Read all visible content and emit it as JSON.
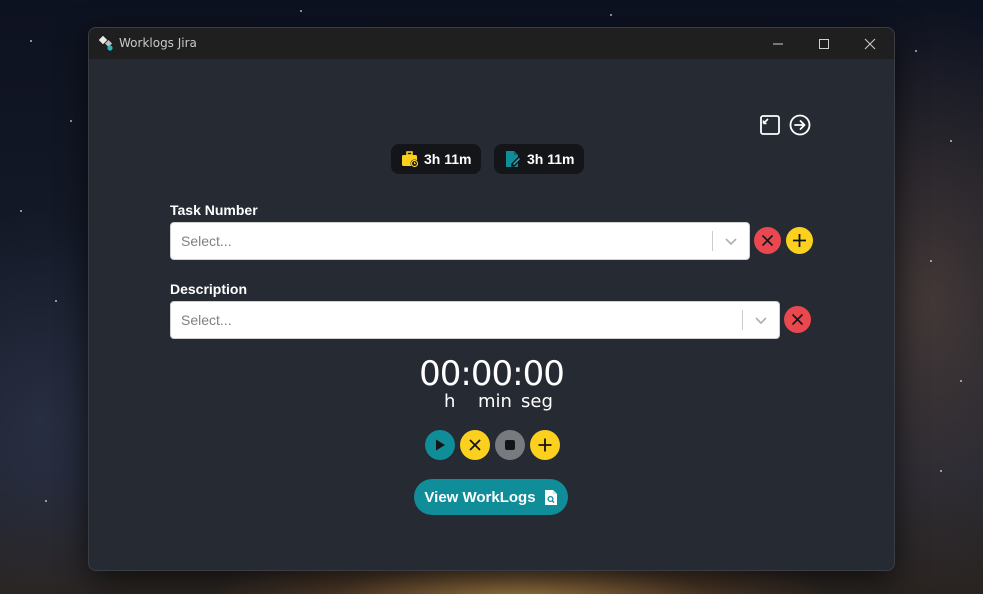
{
  "window": {
    "title": "Worklogs Jira"
  },
  "badges": [
    {
      "icon": "briefcase-clock-icon",
      "value": "3h 11m",
      "color": "#fcd01e"
    },
    {
      "icon": "file-edit-icon",
      "value": "3h 11m",
      "color": "#0f8d99"
    }
  ],
  "task_field": {
    "label": "Task Number",
    "placeholder": "Select..."
  },
  "description_field": {
    "label": "Description",
    "placeholder": "Select..."
  },
  "timer": {
    "display": "00:00:00",
    "units": {
      "h": "h",
      "min": "min",
      "sec": "seg"
    }
  },
  "view_button": {
    "label": "View WorkLogs"
  },
  "colors": {
    "red": "#e9484f",
    "yellow": "#fcd01e",
    "teal": "#0f8d99",
    "gray": "#777a7f"
  }
}
